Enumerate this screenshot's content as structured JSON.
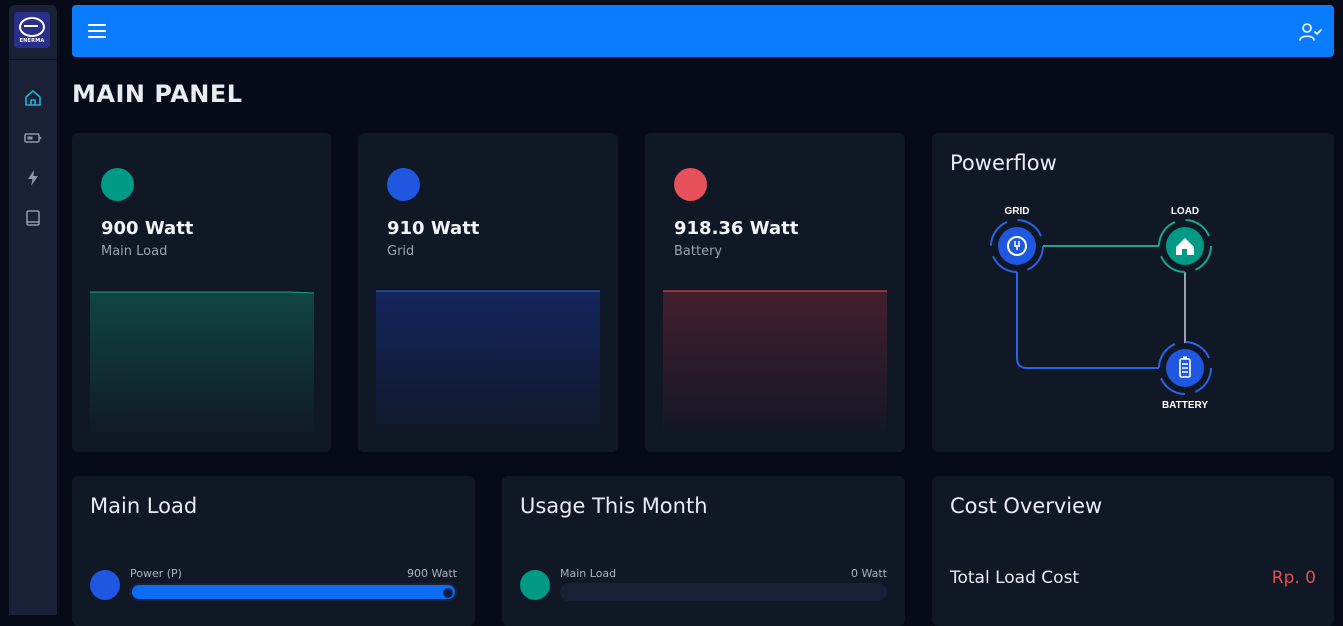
{
  "brand": {
    "logo_text": "ENERMA"
  },
  "page": {
    "title": "MAIN PANEL"
  },
  "stats": [
    {
      "value": "900 Watt",
      "label": "Main Load",
      "color": "#019a84"
    },
    {
      "value": "910 Watt",
      "label": "Grid",
      "color": "#1f57e0"
    },
    {
      "value": "918.36 Watt",
      "label": "Battery",
      "color": "#e8505b"
    }
  ],
  "powerflow": {
    "title": "Powerflow",
    "nodes": {
      "grid": "GRID",
      "load": "LOAD",
      "battery": "BATTERY"
    }
  },
  "main_load": {
    "title": "Main Load",
    "rows": [
      {
        "label": "Power (P)",
        "value": "900 Watt",
        "fill": 1.0,
        "color": "#1f57e0"
      }
    ]
  },
  "usage": {
    "title": "Usage This Month",
    "rows": [
      {
        "label": "Main Load",
        "value": "0 Watt",
        "fill": 0.0,
        "color": "#019a84"
      }
    ]
  },
  "cost": {
    "title": "Cost Overview",
    "rows": [
      {
        "label": "Total Load Cost",
        "value": "Rp. 0"
      }
    ]
  }
}
